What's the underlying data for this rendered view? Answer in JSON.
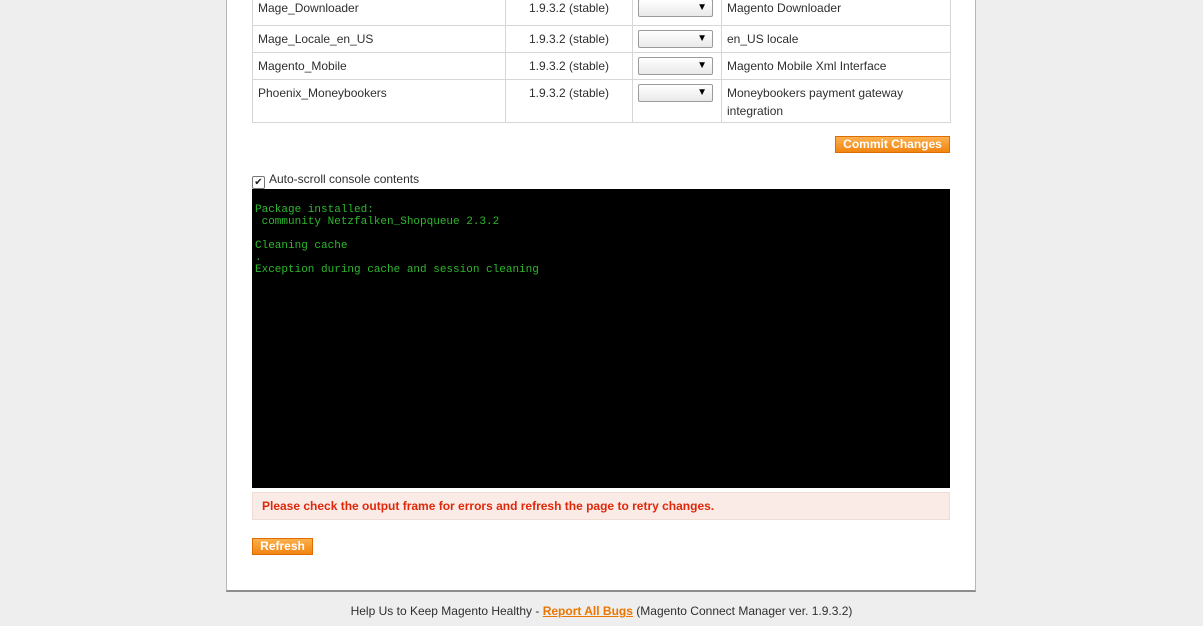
{
  "packages": [
    {
      "name": "Mage_Downloader",
      "version": "1.9.3.2 (stable)",
      "action": "",
      "summary": "Magento Downloader"
    },
    {
      "name": "Mage_Locale_en_US",
      "version": "1.9.3.2 (stable)",
      "action": "",
      "summary": "en_US locale"
    },
    {
      "name": "Magento_Mobile",
      "version": "1.9.3.2 (stable)",
      "action": "",
      "summary": "Magento Mobile Xml Interface"
    },
    {
      "name": "Phoenix_Moneybookers",
      "version": "1.9.3.2 (stable)",
      "action": "",
      "summary": "Moneybookers payment gateway integration"
    }
  ],
  "commit_label": "Commit Changes",
  "autoscroll": {
    "label": "Auto-scroll console contents",
    "checked": true
  },
  "console": {
    "lines": [
      "Package installed:",
      " community Netzfalken_Shopqueue 2.3.2",
      "Cleaning cache",
      ".",
      "Exception during cache and session cleaning"
    ],
    "text_color": "#2db82d",
    "background": "#000000"
  },
  "error_message": "Please check the output frame for errors and refresh the page to retry changes.",
  "refresh_label": "Refresh",
  "footer": {
    "prefix": "Help Us to Keep Magento Healthy - ",
    "link": "Report All Bugs",
    "suffix": " (Magento Connect Manager ver. 1.9.3.2)"
  },
  "colors": {
    "accent_orange": "#f28410",
    "error_red": "#df280a",
    "error_bg": "#faebe7"
  }
}
